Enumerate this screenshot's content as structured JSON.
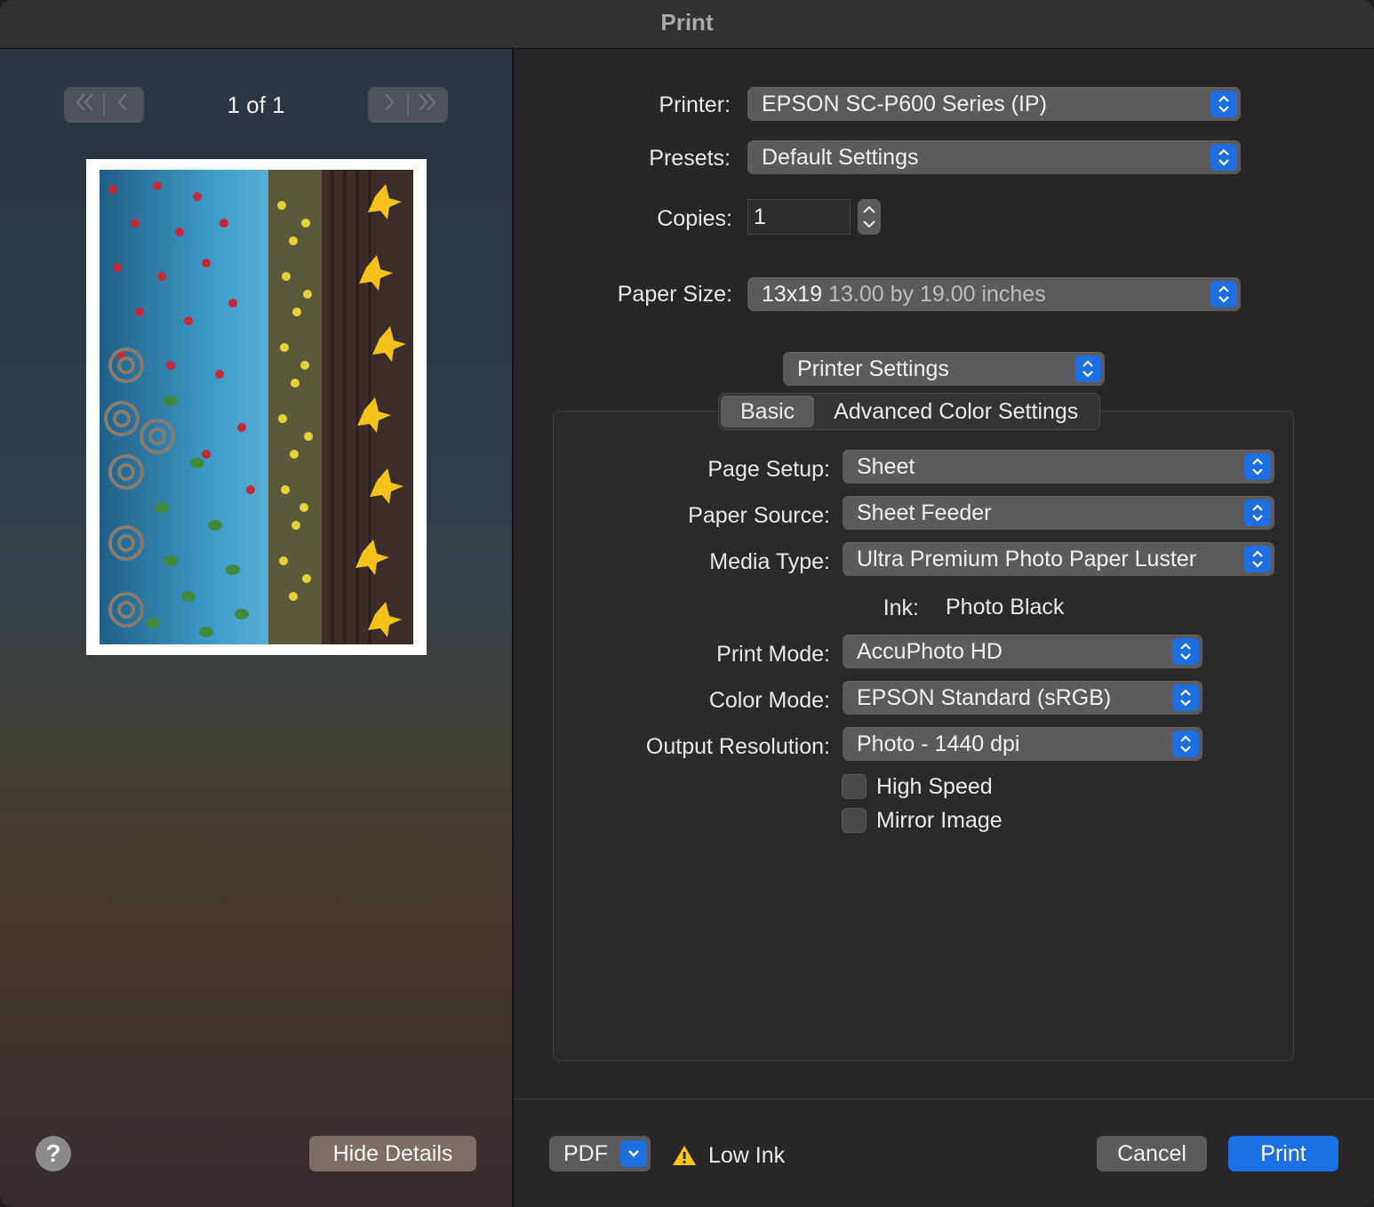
{
  "window": {
    "title": "Print"
  },
  "preview": {
    "page_indicator": "1 of 1",
    "first_icon": "double-chevron-left-icon",
    "prev_icon": "chevron-left-icon",
    "next_icon": "chevron-right-icon",
    "last_icon": "double-chevron-right-icon",
    "help_label": "?",
    "hide_details_label": "Hide Details"
  },
  "settings": {
    "printer": {
      "label": "Printer:",
      "value": "EPSON SC-P600 Series (IP)"
    },
    "presets": {
      "label": "Presets:",
      "value": "Default Settings"
    },
    "copies": {
      "label": "Copies:",
      "value": "1"
    },
    "paper_size": {
      "label": "Paper Size:",
      "value": "13x19",
      "detail": "13.00 by 19.00 inches"
    },
    "section_popup": "Printer Settings",
    "tabs": [
      {
        "label": "Basic",
        "selected": true
      },
      {
        "label": "Advanced Color Settings",
        "selected": false
      }
    ],
    "page_setup": {
      "label": "Page Setup:",
      "value": "Sheet"
    },
    "paper_source": {
      "label": "Paper Source:",
      "value": "Sheet Feeder"
    },
    "media_type": {
      "label": "Media Type:",
      "value": "Ultra Premium Photo Paper Luster"
    },
    "ink": {
      "label": "Ink:",
      "value": "Photo Black"
    },
    "print_mode": {
      "label": "Print Mode:",
      "value": "AccuPhoto HD"
    },
    "color_mode": {
      "label": "Color Mode:",
      "value": "EPSON Standard (sRGB)"
    },
    "output_resolution": {
      "label": "Output Resolution:",
      "value": "Photo - 1440 dpi"
    },
    "high_speed": {
      "label": "High Speed",
      "checked": false
    },
    "mirror_image": {
      "label": "Mirror Image",
      "checked": false
    }
  },
  "footer": {
    "pdf_label": "PDF",
    "warning_text": "Low Ink",
    "warning_icon": "warning-triangle-icon",
    "cancel_label": "Cancel",
    "print_label": "Print"
  },
  "colors": {
    "accent": "#1a6fe3",
    "warning": "#f5c518"
  }
}
